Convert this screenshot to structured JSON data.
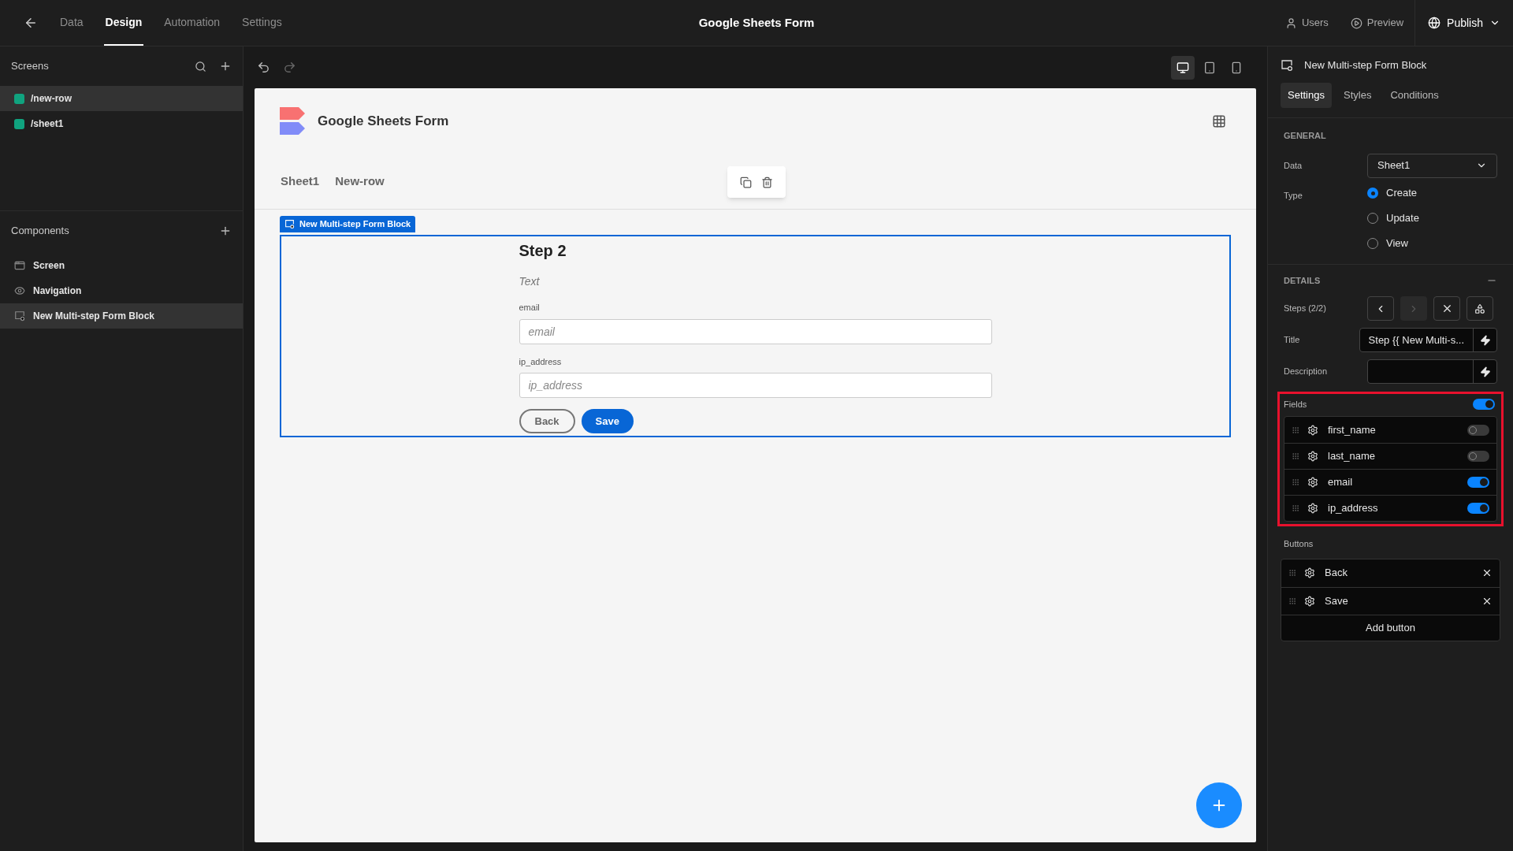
{
  "topbar": {
    "nav": [
      {
        "label": "Data",
        "selected": false
      },
      {
        "label": "Design",
        "selected": true
      },
      {
        "label": "Automation",
        "selected": false
      },
      {
        "label": "Settings",
        "selected": false
      }
    ],
    "title": "Google Sheets Form",
    "actions": [
      {
        "kind": "users",
        "label": "Users"
      },
      {
        "kind": "preview",
        "label": "Preview"
      },
      {
        "kind": "publish",
        "label": "Publish"
      }
    ]
  },
  "screens": {
    "title": "Screens",
    "items": [
      {
        "label": "/new-row",
        "selected": true
      },
      {
        "label": "/sheet1",
        "selected": false
      }
    ]
  },
  "components": {
    "title": "Components",
    "items": [
      {
        "kind": "screen",
        "label": "Screen",
        "selected": false
      },
      {
        "kind": "navigation",
        "label": "Navigation",
        "selected": false
      },
      {
        "kind": "form",
        "label": "New Multi-step Form Block",
        "selected": true
      }
    ]
  },
  "devices": [
    {
      "kind": "desktop",
      "selected": true
    },
    {
      "kind": "tablet",
      "selected": false
    },
    {
      "kind": "mobile",
      "selected": false
    }
  ],
  "canvas": {
    "app_title": "Google Sheets Form",
    "nav": [
      "Sheet1",
      "New-row"
    ],
    "block_label": "New Multi-step Form Block",
    "step_title": "Step 2",
    "description": "Text",
    "fields": [
      {
        "label": "email",
        "placeholder": "email"
      },
      {
        "label": "ip_address",
        "placeholder": "ip_address"
      }
    ],
    "buttons": [
      {
        "kind": "secondary",
        "label": "Back"
      },
      {
        "kind": "primary",
        "label": "Save"
      }
    ]
  },
  "panel": {
    "title": "New Multi-step Form Block",
    "tabs": [
      {
        "label": "Settings",
        "selected": true
      },
      {
        "label": "Styles",
        "selected": false
      },
      {
        "label": "Conditions",
        "selected": false
      }
    ],
    "general": {
      "heading": "GENERAL",
      "data_label": "Data",
      "data_value": "Sheet1",
      "type_label": "Type",
      "types": [
        {
          "label": "Create",
          "selected": true
        },
        {
          "label": "Update",
          "selected": false
        },
        {
          "label": "View",
          "selected": false
        }
      ]
    },
    "details": {
      "heading": "DETAILS",
      "steps_label": "Steps (2/2)",
      "title_label": "Title",
      "title_value": "Step {{ New Multi-s...",
      "description_label": "Description",
      "fields_label": "Fields",
      "fields_on": true,
      "fields": [
        {
          "label": "first_name",
          "on": false
        },
        {
          "label": "last_name",
          "on": false
        },
        {
          "label": "email",
          "on": true
        },
        {
          "label": "ip_address",
          "on": true
        }
      ],
      "buttons_label": "Buttons",
      "buttons": [
        "Back",
        "Save"
      ],
      "add_button": "Add button"
    }
  }
}
